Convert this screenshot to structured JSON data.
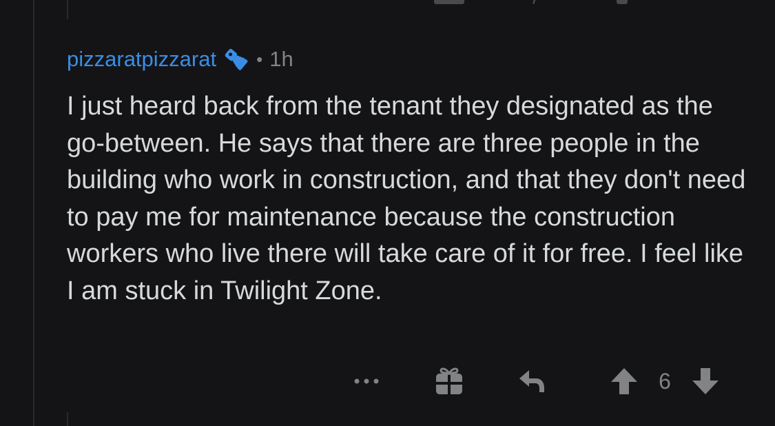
{
  "comment": {
    "username": "pizzaratpizzarat",
    "flair_icon": "flashlight-icon",
    "separator": "•",
    "time": "1h",
    "body": "I just heard back from the tenant they designated as the go-between. He says that there are three people in the building who work in construction, and that they don't need to pay me for maintenance because the construction workers who live there will take care of it for free. I feel like I am stuck in Twilight Zone."
  },
  "actions": {
    "more_icon": "more-dots-icon",
    "award_icon": "gift-icon",
    "reply_icon": "reply-icon",
    "upvote_icon": "upvote-arrow-icon",
    "vote_count": "6",
    "downvote_icon": "downvote-arrow-icon"
  },
  "colors": {
    "background": "#141416",
    "username": "#3a8ee6",
    "body_text": "#d7dadc",
    "muted": "#818384"
  }
}
